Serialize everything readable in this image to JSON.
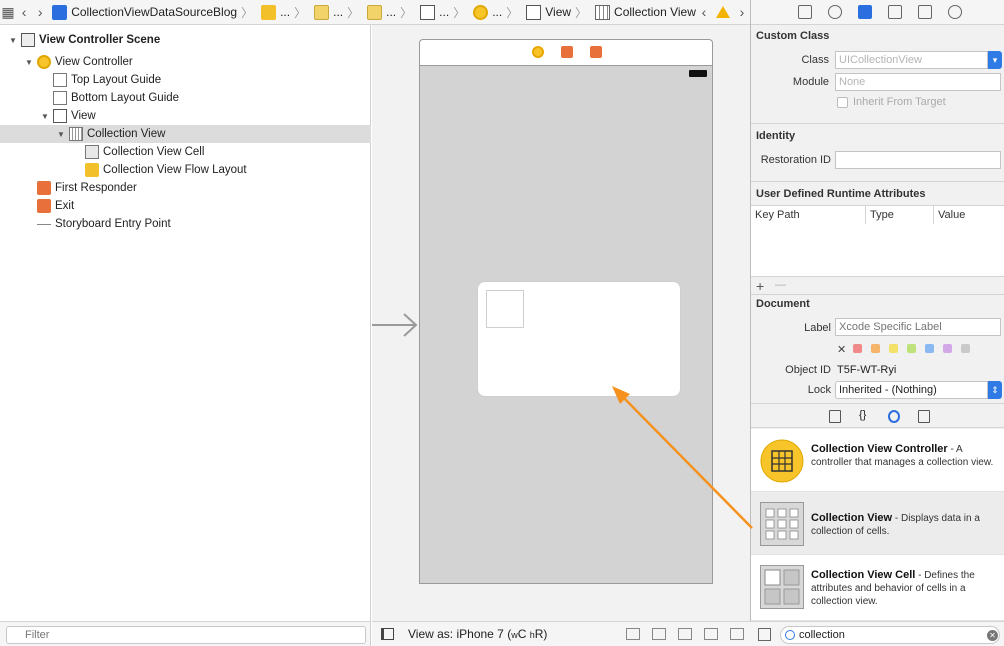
{
  "jumpbar": {
    "crumbs": [
      {
        "label": "CollectionViewDataSourceBlog",
        "icon": "project-file-icon"
      },
      {
        "label": "...",
        "icon": "folder-icon"
      },
      {
        "label": "...",
        "icon": "storyboard-file-icon"
      },
      {
        "label": "...",
        "icon": "storyboard-icon"
      },
      {
        "label": "...",
        "icon": "scene-icon"
      },
      {
        "label": "...",
        "icon": "view-controller-icon"
      },
      {
        "label": "View",
        "icon": "view-icon"
      },
      {
        "label": "Collection View",
        "icon": "collection-view-icon"
      }
    ],
    "warning_icon": "warning-icon"
  },
  "outline": {
    "items": [
      {
        "label": "View Controller Scene",
        "bold": true
      },
      {
        "label": "View Controller"
      },
      {
        "label": "Top Layout Guide"
      },
      {
        "label": "Bottom Layout Guide"
      },
      {
        "label": "View"
      },
      {
        "label": "Collection View",
        "selected": true
      },
      {
        "label": "Collection View Cell"
      },
      {
        "label": "Collection View Flow Layout"
      },
      {
        "label": "First Responder"
      },
      {
        "label": "Exit"
      },
      {
        "label": "Storyboard Entry Point"
      }
    ],
    "filter_placeholder": "Filter"
  },
  "canvas": {
    "view_as_label": "View as: iPhone 7",
    "size_class_w": "w",
    "size_class_wv": "C",
    "size_class_h": "h",
    "size_class_hv": "R)",
    "size_class_open": "("
  },
  "inspector": {
    "custom_class": {
      "title": "Custom Class",
      "class_label": "Class",
      "class_value": "UICollectionView",
      "module_label": "Module",
      "module_value": "None",
      "inherit_label": "Inherit From Target"
    },
    "identity": {
      "title": "Identity",
      "restoration_label": "Restoration ID",
      "restoration_value": ""
    },
    "uda": {
      "title": "User Defined Runtime Attributes",
      "col_key": "Key Path",
      "col_type": "Type",
      "col_value": "Value",
      "add": "+",
      "remove": "—"
    },
    "document": {
      "title": "Document",
      "label_label": "Label",
      "label_placeholder": "Xcode Specific Label",
      "clear_mark": "✕",
      "swatches": [
        "#f08a8a",
        "#f4b46a",
        "#f3e16a",
        "#bfe27a",
        "#8ab8f0",
        "#d3a8e6",
        "#c9c9c9"
      ],
      "object_id_label": "Object ID",
      "object_id_value": "T5F-WT-Ryi",
      "lock_label": "Lock",
      "lock_value": "Inherited - (Nothing)"
    },
    "library": {
      "items": [
        {
          "title": "Collection View Controller",
          "desc": " - A controller that manages a collection view.",
          "icon": "collection-view-controller-icon"
        },
        {
          "title": "Collection View",
          "desc": " - Displays data in a collection of cells.",
          "icon": "collection-view-icon",
          "selected": true
        },
        {
          "title": "Collection View Cell",
          "desc": " - Defines the attributes and behavior of cells in a collection view.",
          "icon": "collection-view-cell-icon"
        }
      ],
      "search_value": "collection"
    }
  },
  "colors": {
    "accent": "#2f7ae5",
    "annotation_arrow": "#f5921e"
  }
}
